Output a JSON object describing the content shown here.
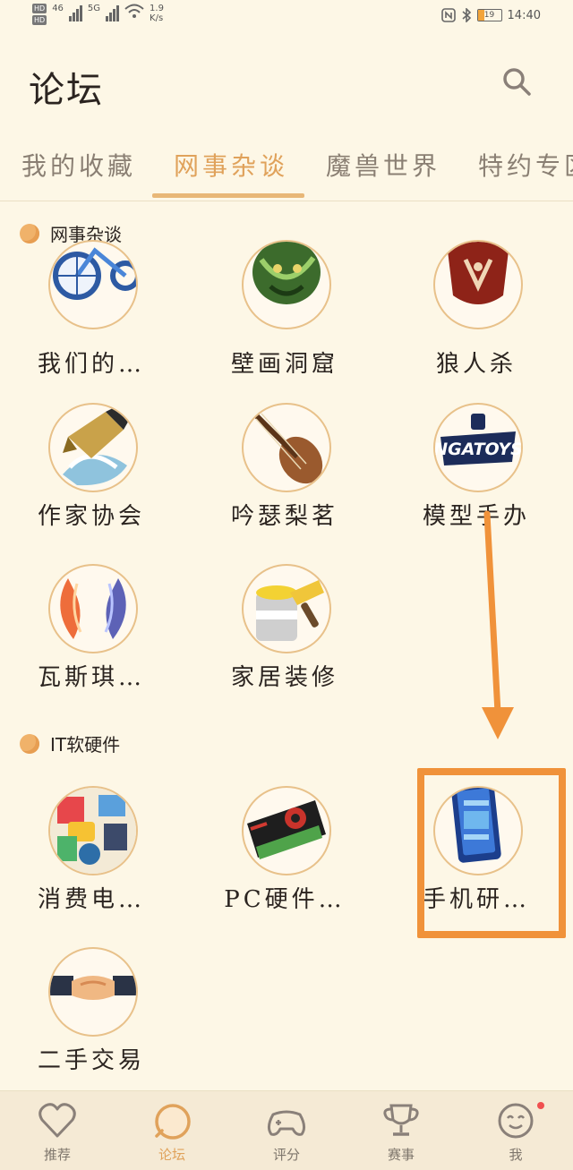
{
  "status_bar": {
    "hd1": "HD",
    "hd2": "HD",
    "net_left": "46",
    "net_right": "5G",
    "speed_value": "1.9",
    "speed_unit": "K/s",
    "battery": "19",
    "time": "14:40"
  },
  "header": {
    "title": "论坛"
  },
  "tabs": [
    {
      "label": "我的收藏"
    },
    {
      "label": "网事杂谈"
    },
    {
      "label": "魔兽世界"
    },
    {
      "label": "特约专区"
    }
  ],
  "sections": [
    {
      "title": "网事杂谈",
      "items": [
        {
          "label": "我们的…",
          "icon": "bicycle-icon"
        },
        {
          "label": "壁画洞窟",
          "icon": "dragon-icon"
        },
        {
          "label": "狼人杀",
          "icon": "werewolf-icon"
        },
        {
          "label": "作家协会",
          "icon": "fountain-pen-icon"
        },
        {
          "label": "吟瑟梨茗",
          "icon": "pipa-icon"
        },
        {
          "label": "模型手办",
          "icon": "ngatoys-logo-icon"
        },
        {
          "label": "瓦斯琪…",
          "icon": "koi-fish-icon"
        },
        {
          "label": "家居装修",
          "icon": "paint-bucket-icon"
        }
      ]
    },
    {
      "title": "IT软硬件",
      "items": [
        {
          "label": "消费电…",
          "icon": "electronics-icon"
        },
        {
          "label": "PC硬件…",
          "icon": "graphics-card-icon"
        },
        {
          "label": "手机研…",
          "icon": "smartphone-icon"
        },
        {
          "label": "二手交易",
          "icon": "handshake-icon"
        }
      ]
    }
  ],
  "bottom_nav": [
    {
      "label": "推荐",
      "icon": "heart-icon"
    },
    {
      "label": "论坛",
      "icon": "forum-icon"
    },
    {
      "label": "评分",
      "icon": "gamepad-icon"
    },
    {
      "label": "赛事",
      "icon": "trophy-icon"
    },
    {
      "label": "我",
      "icon": "face-icon"
    }
  ],
  "colors": {
    "accent": "#e0a25b",
    "background": "#fdf7e6",
    "highlight": "#f0923a"
  }
}
